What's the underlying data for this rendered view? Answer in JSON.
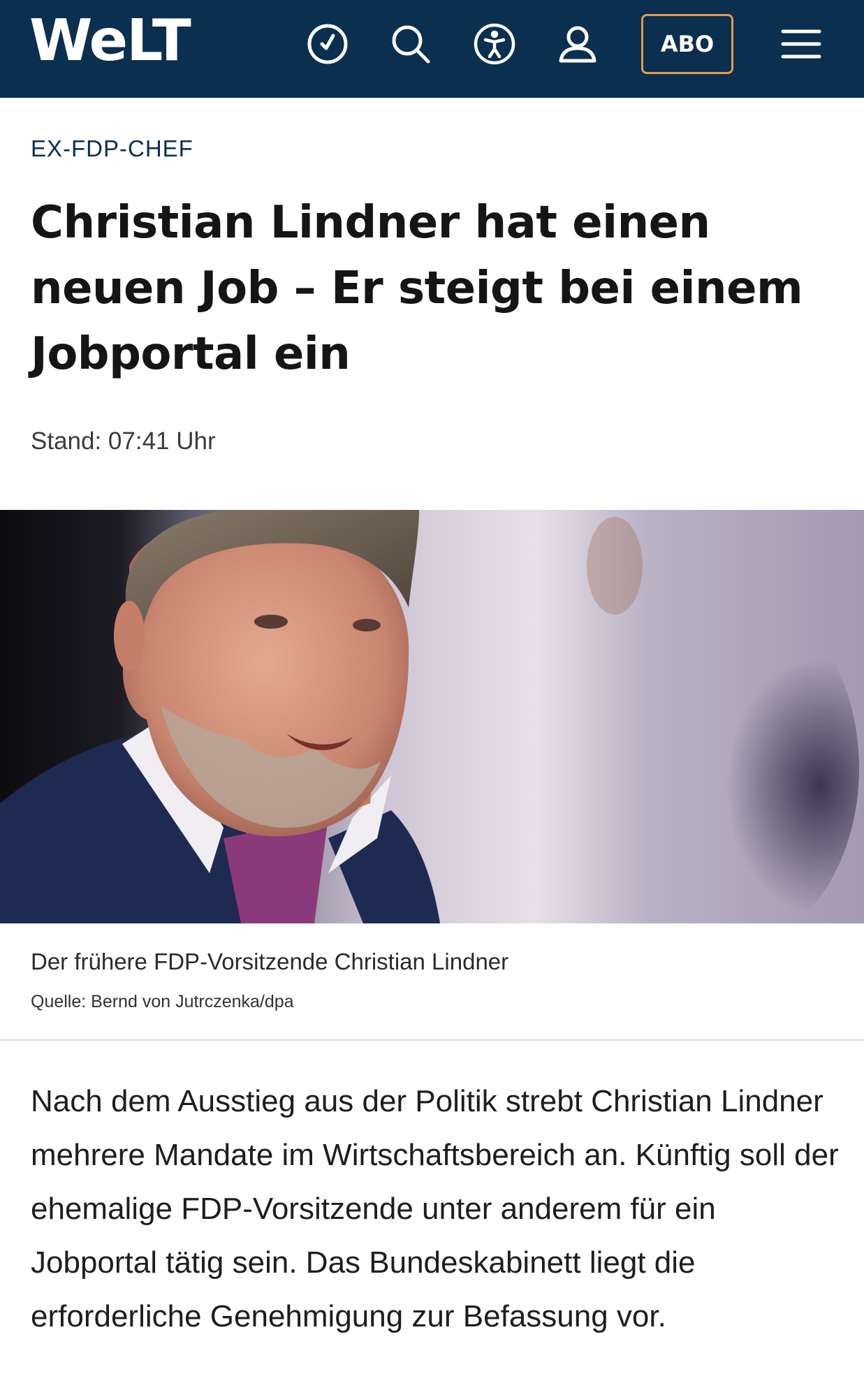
{
  "header": {
    "logo_text": "WeLT",
    "abo_label": "ABO",
    "icons": [
      "clock-check-icon",
      "search-icon",
      "accessibility-icon",
      "user-icon",
      "menu-icon"
    ],
    "background_color": "#0b2f4f",
    "abo_border_color": "#e39a4a"
  },
  "article": {
    "kicker": "EX-FDP-CHEF",
    "headline": "Christian Lindner hat einen neuen Job – Er steigt bei einem Jobportal ein",
    "stand": "Stand: 07:41 Uhr",
    "image_caption": "Der frühere FDP-Vorsitzende Christian Lindner",
    "image_source": "Quelle: Bernd von Jutrczenka/dpa",
    "teaser": "Nach dem Ausstieg aus der Politik strebt Christian Lindner mehrere Mandate im Wirtschaftsbereich an. Künftig soll der ehemalige FDP-Vorsitzende unter anderem für ein Jobportal tätig sein. Das Bundeskabinett liegt die erforderliche Genehmigung zur Befassung vor."
  }
}
